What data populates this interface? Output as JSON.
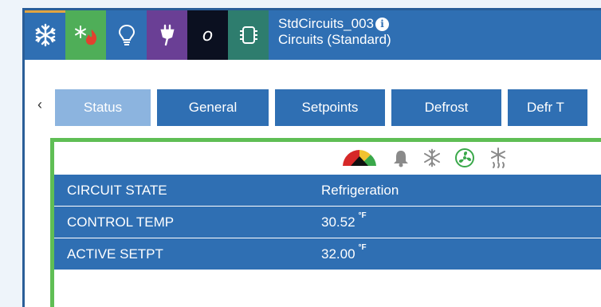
{
  "header": {
    "title": "StdCircuits_003",
    "subtitle": "Circuits (Standard)",
    "info_glyph": "i",
    "categories": [
      {
        "name": "refrigeration",
        "icon": "snowflake-icon",
        "bg": "#2f6fb3",
        "selected": true
      },
      {
        "name": "heat-reclaim",
        "icon": "snowflake-flame-icon",
        "bg": "#4fae58"
      },
      {
        "name": "lighting",
        "icon": "lightbulb-icon",
        "bg": "#2f6fb3"
      },
      {
        "name": "power",
        "icon": "plug-icon",
        "bg": "#6a3f95"
      },
      {
        "name": "other",
        "icon": "letter-o-icon",
        "bg": "#0b1020",
        "glyph": "o"
      },
      {
        "name": "controller",
        "icon": "chip-icon",
        "bg": "#2e7d6e"
      }
    ]
  },
  "tabs": [
    {
      "label": "Status",
      "active": true
    },
    {
      "label": "General"
    },
    {
      "label": "Setpoints"
    },
    {
      "label": "Defrost"
    },
    {
      "label": "Defr T"
    }
  ],
  "scroll_left_glyph": "‹",
  "status_icons": [
    "gauge-icon",
    "bell-icon",
    "snowflake-icon",
    "fan-icon",
    "defrost-icon"
  ],
  "rows": [
    {
      "label": "CIRCUIT STATE",
      "value": "Refrigeration",
      "unit": ""
    },
    {
      "label": "CONTROL TEMP",
      "value": "30.52",
      "unit": "°F"
    },
    {
      "label": "ACTIVE SETPT",
      "value": "32.00",
      "unit": "°F"
    }
  ]
}
